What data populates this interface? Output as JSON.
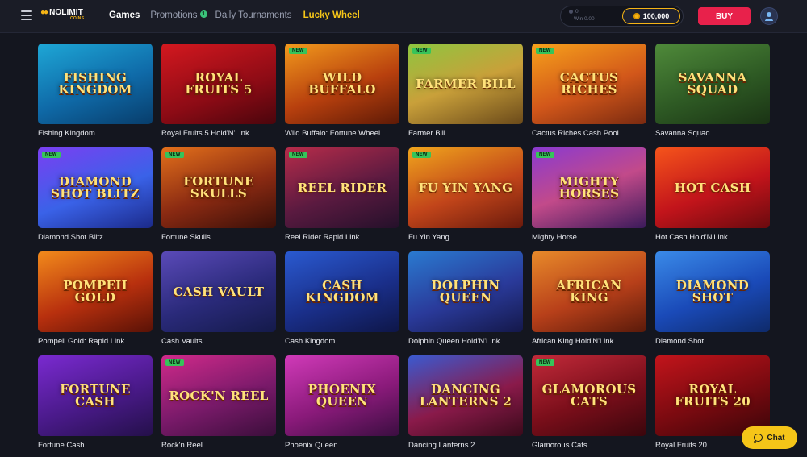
{
  "header": {
    "logo_text": "NOLIMIT",
    "logo_sub": "COINS",
    "nav": {
      "games": "Games",
      "promotions": "Promotions",
      "promotions_badge": "1",
      "tournaments": "Daily Tournaments",
      "lucky_wheel": "Lucky Wheel"
    },
    "wallet": {
      "win_count": "0",
      "win_label": "Win",
      "win_value": "0.00",
      "coins": "100,000"
    },
    "buy_label": "BUY"
  },
  "colors": {
    "background": "#14161f",
    "accent_gold": "#f5c518",
    "buy_red": "#e8214b",
    "new_green": "#36c45a"
  },
  "new_badge_label": "NEW",
  "games": [
    {
      "title": "Fishing Kingdom",
      "art": "Fishing Kingdom",
      "is_new": false,
      "bg": "linear-gradient(160deg,#1ea7d6 0%,#0f6aa8 55%,#083d6b 100%)"
    },
    {
      "title": "Royal Fruits 5 Hold'N'Link",
      "art": "Royal Fruits 5",
      "is_new": false,
      "bg": "linear-gradient(160deg,#d4181f 0%,#8c0b15 60%,#4a050c 100%)"
    },
    {
      "title": "Wild Buffalo: Fortune Wheel",
      "art": "Wild Buffalo",
      "is_new": true,
      "bg": "linear-gradient(160deg,#f29a1c 0%,#b8400e 55%,#5e1a06 100%)"
    },
    {
      "title": "Farmer Bill",
      "art": "Farmer Bill",
      "is_new": true,
      "bg": "linear-gradient(160deg,#8dc63f 0%,#c9a03a 50%,#6b4a1a 100%)"
    },
    {
      "title": "Cactus Riches Cash Pool",
      "art": "Cactus Riches",
      "is_new": true,
      "bg": "linear-gradient(160deg,#f7a21b 0%,#d2571a 55%,#7a2a10 100%)"
    },
    {
      "title": "Savanna Squad",
      "art": "Savanna Squad",
      "is_new": false,
      "bg": "linear-gradient(160deg,#4f8a3a 0%,#2e5a24 55%,#1a3314 100%)"
    },
    {
      "title": "Diamond Shot Blitz",
      "art": "Diamond Shot Blitz",
      "is_new": true,
      "bg": "linear-gradient(160deg,#7a3ff2 0%,#3a62e8 55%,#1b2a8a 100%)"
    },
    {
      "title": "Fortune Skulls",
      "art": "Fortune Skulls",
      "is_new": true,
      "bg": "linear-gradient(160deg,#e3701b 0%,#8a2a12 55%,#3a0f08 100%)"
    },
    {
      "title": "Reel Rider Rapid Link",
      "art": "Reel Rider",
      "is_new": true,
      "bg": "linear-gradient(160deg,#b72c4a 0%,#5a1a40 55%,#24102a 100%)"
    },
    {
      "title": "Fu Yin Yang",
      "art": "Fu Yin Yang",
      "is_new": true,
      "bg": "linear-gradient(160deg,#f0a51c 0%,#c2451a 55%,#6a1a0c 100%)"
    },
    {
      "title": "Mighty Horse",
      "art": "Mighty Horses",
      "is_new": true,
      "bg": "linear-gradient(160deg,#8a3ad0 0%,#c24a8a 50%,#3a1a5a 100%)"
    },
    {
      "title": "Hot Cash Hold'N'Link",
      "art": "Hot Cash",
      "is_new": false,
      "bg": "linear-gradient(160deg,#f5541b 0%,#c2141b 55%,#6a0a0e 100%)"
    },
    {
      "title": "Pompeii Gold: Rapid Link",
      "art": "Pompeii Gold",
      "is_new": false,
      "bg": "linear-gradient(160deg,#f28a1b 0%,#b8300e 55%,#5a1206 100%)"
    },
    {
      "title": "Cash Vaults",
      "art": "Cash Vault",
      "is_new": false,
      "bg": "linear-gradient(160deg,#5a4ab8 0%,#2a2a7a 55%,#141a4a 100%)"
    },
    {
      "title": "Cash Kingdom",
      "art": "Cash Kingdom",
      "is_new": false,
      "bg": "linear-gradient(160deg,#2a5ad0 0%,#1a2f8a 55%,#0e1648 100%)"
    },
    {
      "title": "Dolphin Queen Hold'N'Link",
      "art": "Dolphin Queen",
      "is_new": false,
      "bg": "linear-gradient(160deg,#2a7ad0 0%,#2a3a9a 55%,#14184a 100%)"
    },
    {
      "title": "African King Hold'N'Link",
      "art": "African King",
      "is_new": false,
      "bg": "linear-gradient(160deg,#e88a2a 0%,#b8401a 55%,#5a1a0a 100%)"
    },
    {
      "title": "Diamond Shot",
      "art": "Diamond Shot",
      "is_new": false,
      "bg": "linear-gradient(160deg,#3a8ae8 0%,#1a4ab8 55%,#0e2a6a 100%)"
    },
    {
      "title": "Fortune Cash",
      "art": "Fortune Cash",
      "is_new": false,
      "bg": "linear-gradient(160deg,#7a2ad0 0%,#4a1a8a 55%,#24104a 100%)"
    },
    {
      "title": "Rock'n Reel",
      "art": "Rock'n Reel",
      "is_new": true,
      "bg": "linear-gradient(160deg,#d02a8a 0%,#7a1a6a 55%,#3a0e3a 100%)"
    },
    {
      "title": "Phoenix Queen",
      "art": "Phoenix Queen",
      "is_new": false,
      "bg": "linear-gradient(160deg,#d03ab8 0%,#8a1a7a 55%,#3a0e40 100%)"
    },
    {
      "title": "Dancing Lanterns 2",
      "art": "Dancing Lanterns 2",
      "is_new": false,
      "bg": "linear-gradient(160deg,#3a5ad0 0%,#8a1a4a 55%,#3a0a1a 100%)"
    },
    {
      "title": "Glamorous Cats",
      "art": "Glamorous Cats",
      "is_new": true,
      "bg": "linear-gradient(160deg,#c22a3a 0%,#7a0e1a 55%,#3a060c 100%)"
    },
    {
      "title": "Royal Fruits 20",
      "art": "Royal Fruits 20",
      "is_new": false,
      "bg": "linear-gradient(160deg,#c2141b 0%,#7a0a10 55%,#3a0508 100%)"
    }
  ],
  "chat_label": "Chat"
}
